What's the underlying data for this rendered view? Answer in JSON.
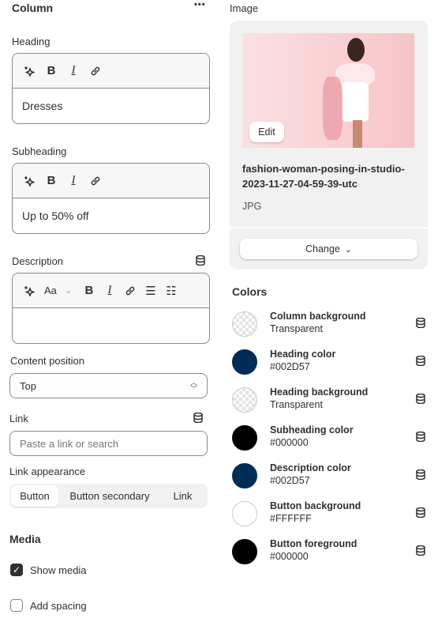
{
  "column": {
    "title": "Column",
    "more": "•••"
  },
  "heading": {
    "label": "Heading",
    "value": "Dresses"
  },
  "subheading": {
    "label": "Subheading",
    "value": "Up to 50% off"
  },
  "description": {
    "label": "Description",
    "value": "",
    "font_label": "Aa"
  },
  "toolbar": {
    "bold": "B",
    "italic": "I"
  },
  "content_position": {
    "label": "Content position",
    "value": "Top"
  },
  "link": {
    "label": "Link",
    "placeholder": "Paste a link or search"
  },
  "link_appearance": {
    "label": "Link appearance",
    "options": [
      "Button",
      "Button secondary",
      "Link"
    ],
    "selected": "Button"
  },
  "media": {
    "title": "Media",
    "show_media": {
      "label": "Show media",
      "checked": true
    },
    "add_spacing": {
      "label": "Add spacing",
      "checked": false
    }
  },
  "image": {
    "label": "Image",
    "edit": "Edit",
    "filename_1": "fashion-woman-posing-in-studio-",
    "filename_2": "2023-11-27-04-59-39-utc",
    "type": "JPG",
    "change": "Change"
  },
  "colors": {
    "title": "Colors",
    "items": [
      {
        "name": "Column background",
        "value": "Transparent",
        "color": "transparent"
      },
      {
        "name": "Heading color",
        "value": "#002D57",
        "color": "#002D57"
      },
      {
        "name": "Heading background",
        "value": "Transparent",
        "color": "transparent"
      },
      {
        "name": "Subheading color",
        "value": "#000000",
        "color": "#000000"
      },
      {
        "name": "Description color",
        "value": "#002D57",
        "color": "#002D57"
      },
      {
        "name": "Button background",
        "value": "#FFFFFF",
        "color": "#FFFFFF"
      },
      {
        "name": "Button foreground",
        "value": "#000000",
        "color": "#000000"
      }
    ]
  }
}
